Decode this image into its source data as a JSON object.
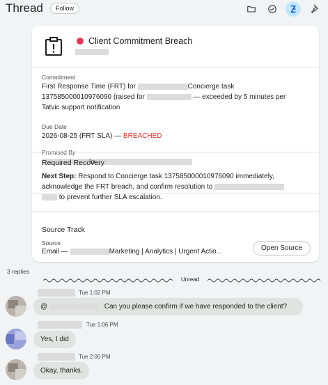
{
  "header": {
    "title": "Thread",
    "follow_label": "Follow",
    "icons": [
      "folder-icon",
      "check-circle-icon",
      "summary-icon",
      "pin-icon"
    ]
  },
  "card": {
    "title": "Client Commitment Breach",
    "status_color": "#e0385a",
    "commitment": {
      "label": "Commitment",
      "line1_a": "First Response Time (FRT) for",
      "line1_b": "Concierge task",
      "line2_a": "137585000010976090 (raised for",
      "line2_b": "— exceeded by 5 minutes per",
      "line3": "Tatvic support notification"
    },
    "due_date": {
      "label": "Due Date",
      "value": "2026-08-25 (FRT SLA) —",
      "status": "BREACHED"
    },
    "promised_by": {
      "label": "Promised By",
      "connector": "to"
    },
    "recovery": {
      "title": "Required Recovery",
      "next_step_label": "Next Step:",
      "line1": "Respond to Concierge task 137585000010976090 immediately,",
      "line2": "acknowledge the FRT breach, and confirm resolution to",
      "line3": "to prevent further SLA escalation."
    },
    "source_track": {
      "title": "Source Track",
      "source_label": "Source",
      "source_prefix": "Email —",
      "source_suffix": "Marketing | Analytics | Urgent Actio...",
      "open_source_label": "Open Source"
    }
  },
  "replies": {
    "count_label": "3 replies",
    "unread_label": "Unread",
    "messages": [
      {
        "time": "Tue 1:02 PM",
        "mention": "@",
        "text": "Can you please confirm if we have responded to the client?"
      },
      {
        "time": "Tue 1:06 PM",
        "text": "Yes, I did"
      },
      {
        "time": "Tue 2:00 PM",
        "text": "Okay, thanks."
      }
    ]
  },
  "colors": {
    "accent": "#c2e7ff",
    "breached": "#d93025",
    "bubble": "#e1e3e1",
    "background": "#f1f3f4"
  }
}
